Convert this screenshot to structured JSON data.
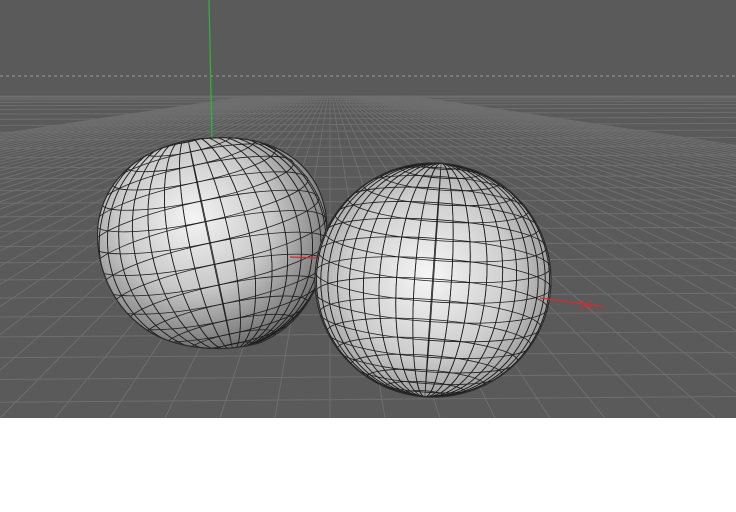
{
  "viewport": {
    "background_color": "#5a5a5a",
    "grid_line_color": "#6e6e6e",
    "horizon_color": "#8a8a8a",
    "axis_y_color": "#2fb53a",
    "axis_x_color": "#d62b2b",
    "object_fill_light": "#e6e6e6",
    "object_fill_dark": "#3a3a3a",
    "wire_color": "#1e1e1e"
  },
  "scene": {
    "objects": [
      {
        "name": "deformed-sphere"
      },
      {
        "name": "sphere"
      }
    ]
  },
  "below_area": {
    "background_color": "#ffffff"
  }
}
